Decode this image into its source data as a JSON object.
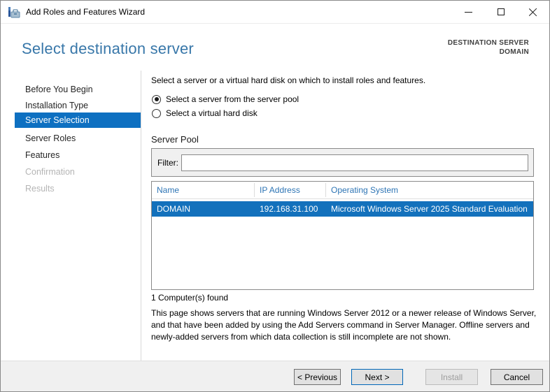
{
  "window": {
    "title": "Add Roles and Features Wizard",
    "controls": [
      "minimize",
      "maximize",
      "close"
    ]
  },
  "header": {
    "title": "Select destination server",
    "destination_label": "DESTINATION SERVER",
    "destination_value": "DOMAIN"
  },
  "sidebar": {
    "items": [
      {
        "label": "Before You Begin",
        "state": "enabled"
      },
      {
        "label": "Installation Type",
        "state": "enabled"
      },
      {
        "label": "Server Selection",
        "state": "selected"
      },
      {
        "label": "Server Roles",
        "state": "enabled"
      },
      {
        "label": "Features",
        "state": "enabled"
      },
      {
        "label": "Confirmation",
        "state": "disabled"
      },
      {
        "label": "Results",
        "state": "disabled"
      }
    ]
  },
  "main": {
    "intro": "Select a server or a virtual hard disk on which to install roles and features.",
    "radios": [
      {
        "label": "Select a server from the server pool",
        "selected": true
      },
      {
        "label": "Select a virtual hard disk",
        "selected": false
      }
    ],
    "server_pool": {
      "label": "Server Pool",
      "filter_label": "Filter:",
      "filter_value": "",
      "table": {
        "columns": [
          "Name",
          "IP Address",
          "Operating System"
        ],
        "rows": [
          {
            "name": "DOMAIN",
            "ip": "192.168.31.100",
            "os": "Microsoft Windows Server 2025 Standard Evaluation",
            "selected": true
          }
        ]
      },
      "count_text": "1 Computer(s) found"
    },
    "description": "This page shows servers that are running Windows Server 2012 or a newer release of Windows Server, and that have been added by using the Add Servers command in Server Manager. Offline servers and newly-added servers from which data collection is still incomplete are not shown."
  },
  "footer": {
    "buttons": [
      {
        "label": "< Previous",
        "state": "enabled"
      },
      {
        "label": "Next >",
        "state": "default"
      },
      {
        "label": "Install",
        "state": "disabled"
      },
      {
        "label": "Cancel",
        "state": "enabled"
      }
    ]
  },
  "colors": {
    "accent_blue": "#0e70c1",
    "selection_blue": "#1371bc",
    "title_blue": "#3877a9",
    "table_header_blue": "#2e75b5",
    "next_border_blue": "#0067b8",
    "footer_gray": "#f0f0f0",
    "panel_gray": "#f0f0f0"
  }
}
